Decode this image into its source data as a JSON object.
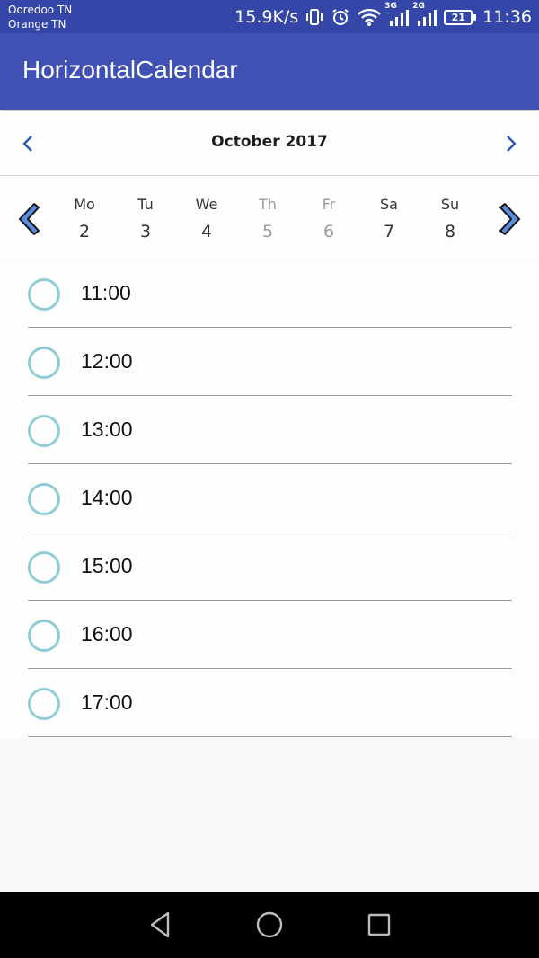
{
  "status_bar": {
    "carrier1": "Ooredoo TN",
    "carrier2": "Orange TN",
    "speed": "15.9K/s",
    "net1": "3G",
    "net2": "2G",
    "battery": "21",
    "time": "11:36"
  },
  "app_bar": {
    "title": "HorizontalCalendar"
  },
  "calendar": {
    "month_label": "October 2017",
    "days": [
      {
        "name": "Mo",
        "date": "2",
        "disabled": false
      },
      {
        "name": "Tu",
        "date": "3",
        "disabled": false
      },
      {
        "name": "We",
        "date": "4",
        "disabled": false
      },
      {
        "name": "Th",
        "date": "5",
        "disabled": true
      },
      {
        "name": "Fr",
        "date": "6",
        "disabled": true
      },
      {
        "name": "Sa",
        "date": "7",
        "disabled": false
      },
      {
        "name": "Su",
        "date": "8",
        "disabled": false
      }
    ]
  },
  "time_slots": [
    "11:00",
    "12:00",
    "13:00",
    "14:00",
    "15:00",
    "16:00",
    "17:00"
  ],
  "colors": {
    "primary": "#3f51b5",
    "primary_dark": "#3446a8",
    "radio_ring": "#8ecdd3",
    "arrow_fill": "#5b8be0"
  },
  "icons": {
    "nav": [
      "back-icon",
      "home-icon",
      "recents-icon"
    ]
  }
}
